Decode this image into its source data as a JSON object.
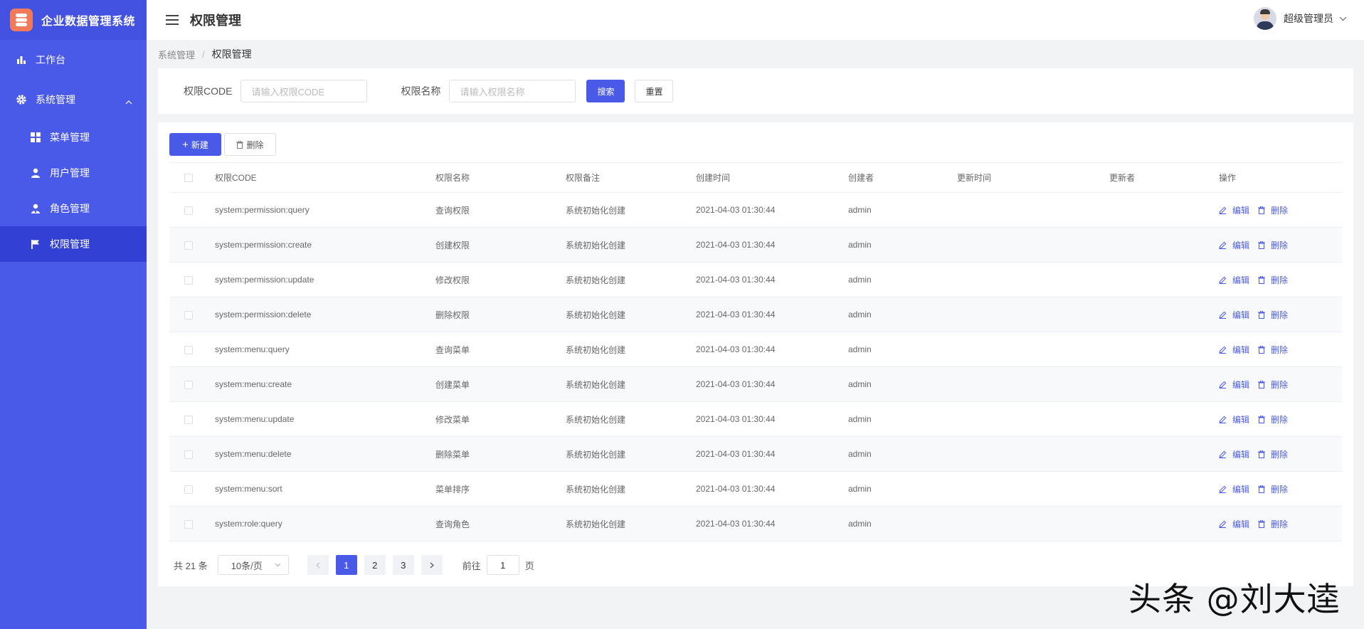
{
  "app": {
    "title": "企业数据管理系统"
  },
  "sidebar": {
    "items": [
      {
        "label": "工作台",
        "icon": "bar-chart-icon"
      },
      {
        "label": "系统管理",
        "icon": "gear-icon"
      }
    ],
    "sub_items": [
      {
        "label": "菜单管理",
        "icon": "grid-icon"
      },
      {
        "label": "用户管理",
        "icon": "user-icon"
      },
      {
        "label": "角色管理",
        "icon": "role-icon"
      },
      {
        "label": "权限管理",
        "icon": "flag-icon",
        "active": true
      }
    ]
  },
  "header": {
    "title": "权限管理",
    "user": "超级管理员"
  },
  "breadcrumb": {
    "parent": "系统管理",
    "separator": "/",
    "current": "权限管理"
  },
  "search": {
    "code_label": "权限CODE",
    "code_placeholder": "请输入权限CODE",
    "name_label": "权限名称",
    "name_placeholder": "请输入权限名称",
    "search_btn": "搜索",
    "reset_btn": "重置"
  },
  "toolbar": {
    "new_label": "新建",
    "delete_label": "删除"
  },
  "table": {
    "columns": [
      "权限CODE",
      "权限名称",
      "权限备注",
      "创建时间",
      "创建者",
      "更新时间",
      "更新者",
      "操作"
    ],
    "edit_label": "编辑",
    "delete_label": "删除",
    "rows": [
      {
        "code": "system:permission:query",
        "name": "查询权限",
        "remark": "系统初始化创建",
        "created": "2021-04-03 01:30:44",
        "creator": "admin",
        "updated": "",
        "updater": ""
      },
      {
        "code": "system:permission:create",
        "name": "创建权限",
        "remark": "系统初始化创建",
        "created": "2021-04-03 01:30:44",
        "creator": "admin",
        "updated": "",
        "updater": ""
      },
      {
        "code": "system:permission:update",
        "name": "修改权限",
        "remark": "系统初始化创建",
        "created": "2021-04-03 01:30:44",
        "creator": "admin",
        "updated": "",
        "updater": ""
      },
      {
        "code": "system:permission:delete",
        "name": "删除权限",
        "remark": "系统初始化创建",
        "created": "2021-04-03 01:30:44",
        "creator": "admin",
        "updated": "",
        "updater": ""
      },
      {
        "code": "system:menu:query",
        "name": "查询菜单",
        "remark": "系统初始化创建",
        "created": "2021-04-03 01:30:44",
        "creator": "admin",
        "updated": "",
        "updater": ""
      },
      {
        "code": "system:menu:create",
        "name": "创建菜单",
        "remark": "系统初始化创建",
        "created": "2021-04-03 01:30:44",
        "creator": "admin",
        "updated": "",
        "updater": ""
      },
      {
        "code": "system:menu:update",
        "name": "修改菜单",
        "remark": "系统初始化创建",
        "created": "2021-04-03 01:30:44",
        "creator": "admin",
        "updated": "",
        "updater": ""
      },
      {
        "code": "system:menu:delete",
        "name": "删除菜单",
        "remark": "系统初始化创建",
        "created": "2021-04-03 01:30:44",
        "creator": "admin",
        "updated": "",
        "updater": ""
      },
      {
        "code": "system:menu:sort",
        "name": "菜单排序",
        "remark": "系统初始化创建",
        "created": "2021-04-03 01:30:44",
        "creator": "admin",
        "updated": "",
        "updater": ""
      },
      {
        "code": "system:role:query",
        "name": "查询角色",
        "remark": "系统初始化创建",
        "created": "2021-04-03 01:30:44",
        "creator": "admin",
        "updated": "",
        "updater": ""
      }
    ]
  },
  "pagination": {
    "total": "共 21 条",
    "page_size": "10条/页",
    "pages": [
      "1",
      "2",
      "3"
    ],
    "current": "1",
    "goto_prefix": "前往",
    "goto_value": "1",
    "goto_suffix": "页"
  },
  "watermark": "头条 @刘大逵",
  "colors": {
    "primary": "#4a5ae8",
    "sidebar_active": "#3241d4",
    "logo": "#f07a5a"
  }
}
